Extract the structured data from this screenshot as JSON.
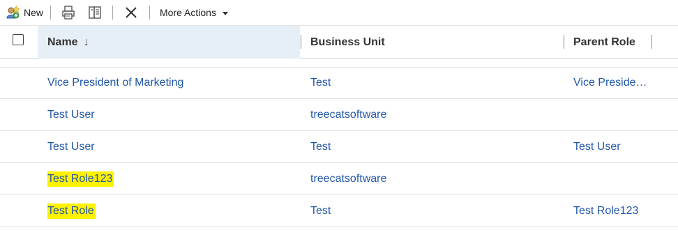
{
  "toolbar": {
    "new_label": "New",
    "more_actions_label": "More Actions"
  },
  "grid": {
    "columns": {
      "name": "Name",
      "business_unit": "Business Unit",
      "parent_role": "Parent Role"
    },
    "sort_indicator": "↓",
    "rows": [
      {
        "name": "Vice President of Marketing",
        "business_unit": "Test",
        "parent_role": "Vice President of Sales",
        "highlight": false
      },
      {
        "name": "Test User",
        "business_unit": "treecatsoftware",
        "parent_role": "",
        "highlight": false
      },
      {
        "name": "Test User",
        "business_unit": "Test",
        "parent_role": "Test User",
        "highlight": false
      },
      {
        "name": "Test Role123",
        "business_unit": "treecatsoftware",
        "parent_role": "",
        "highlight": true
      },
      {
        "name": "Test Role",
        "business_unit": "Test",
        "parent_role": "Test Role123",
        "highlight": true
      }
    ]
  },
  "colors": {
    "link": "#2157a8",
    "highlight": "#fff200",
    "header_selected_bg": "#e6eef6"
  },
  "icons": {
    "new": "new-role-icon",
    "print": "print-icon",
    "export": "export-icon",
    "delete": "delete-icon",
    "more_actions": "chevron-down-icon"
  }
}
